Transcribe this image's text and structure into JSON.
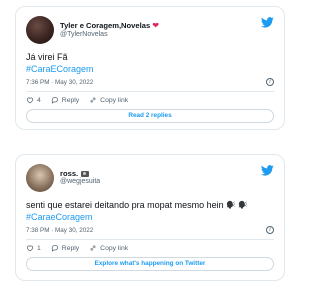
{
  "tweets": [
    {
      "display_name": "Tyler e Coragem,Novelas",
      "display_name_emoji": "heart",
      "handle": "@TylerNovelas",
      "text": "Já virei Fã",
      "hashtag": "#CaraECoragem",
      "timestamp": "7:36 PM · May 30, 2022",
      "likes": "4",
      "reply_label": "Reply",
      "copy_label": "Copy link",
      "cta_label": "Read 2 replies"
    },
    {
      "display_name": "ross.",
      "display_name_emoji": "camera",
      "handle": "@wegjesuita",
      "text": "senti que estarei deitando pra mopat mesmo hein",
      "text_emoji": "speaking-head",
      "hashtag": "#CaraeCoragem",
      "timestamp": "7:38 PM · May 30, 2022",
      "likes": "1",
      "reply_label": "Reply",
      "copy_label": "Copy link",
      "cta_label": "Explore what's happening on Twitter"
    }
  ],
  "colors": {
    "accent": "#1d9bf0",
    "heart": "#e0245e",
    "secondary_text": "#536471",
    "border": "#e1e8ed"
  }
}
